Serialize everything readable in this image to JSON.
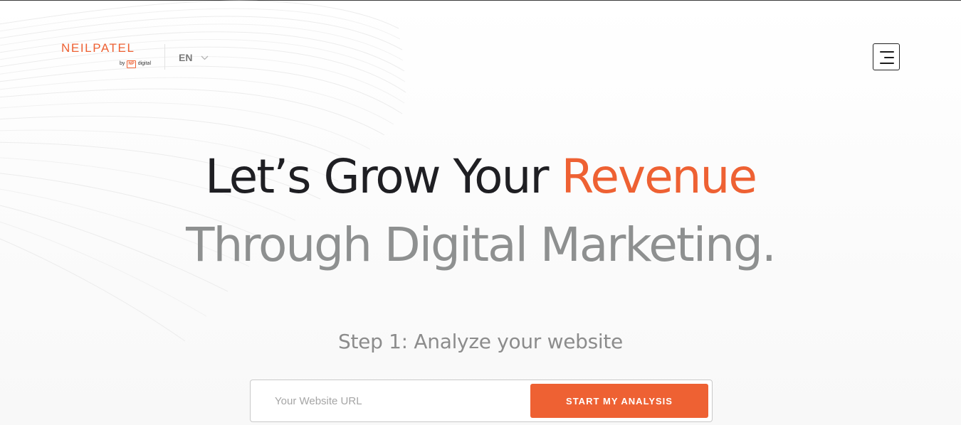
{
  "brand": {
    "name": "NEILPATEL",
    "by": "by",
    "np_badge": "NP",
    "np_word": "digital",
    "accent_color": "#ee6133"
  },
  "header": {
    "language": "EN",
    "language_icon": "chevron-down-icon",
    "menu_icon": "hamburger-menu-icon"
  },
  "hero": {
    "line1_prefix": "Let’s Grow Your ",
    "line1_accent": "Revenue",
    "line2": "Through Digital Marketing.",
    "step": "Step 1: Analyze your website"
  },
  "form": {
    "url_placeholder": "Your Website URL",
    "url_value": "",
    "submit_label": "START MY ANALYSIS"
  }
}
